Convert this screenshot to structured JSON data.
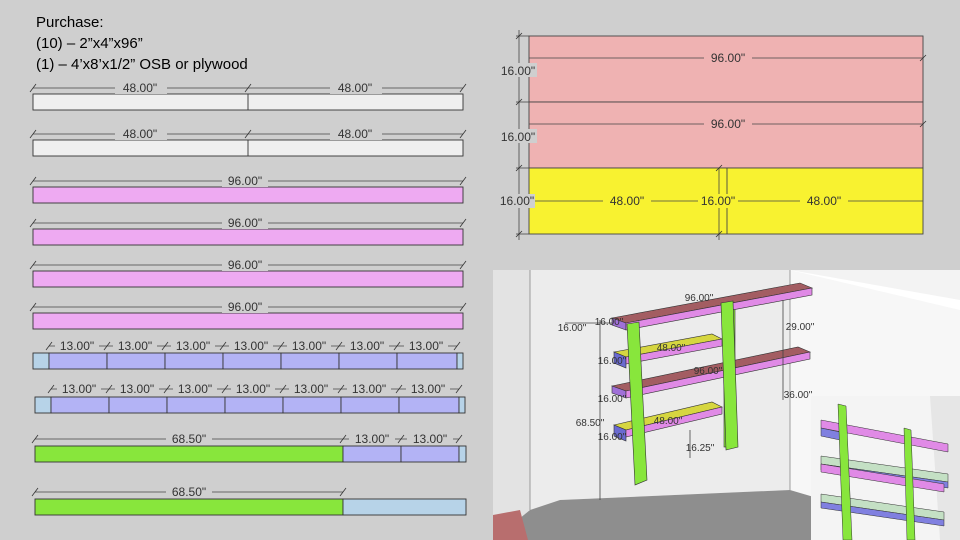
{
  "purchase": {
    "heading": "Purchase:",
    "item1": "(10) – 2”x4”x96”",
    "item2": "(1) – 4’x8’x1/2” OSB or plywood"
  },
  "colors": {
    "background": "#cfcfcf",
    "uncut": "#efefef",
    "long_board": "#eeaaf2",
    "short_piece": "#b3b3f5",
    "leg": "#88e63c",
    "waste": "#b7d3e8",
    "sheet_top": "#efb2b2",
    "sheet_shelf": "#f8f230"
  },
  "boards": {
    "row1": {
      "labels": [
        "48.00\"",
        "48.00\""
      ]
    },
    "row2": {
      "labels": [
        "48.00\"",
        "48.00\""
      ]
    },
    "row3": {
      "label": "96.00\""
    },
    "row4": {
      "label": "96.00\""
    },
    "row5": {
      "label": "96.00\""
    },
    "row6": {
      "label": "96.00\""
    },
    "row7": {
      "labels": [
        "13.00\"",
        "13.00\"",
        "13.00\"",
        "13.00\"",
        "13.00\"",
        "13.00\"",
        "13.00\""
      ]
    },
    "row8": {
      "labels": [
        "13.00\"",
        "13.00\"",
        "13.00\"",
        "13.00\"",
        "13.00\"",
        "13.00\"",
        "13.00\""
      ]
    },
    "row9": {
      "labels": [
        "68.50\"",
        "13.00\"",
        "13.00\""
      ]
    },
    "row10": {
      "label": "68.50\""
    }
  },
  "sheet": {
    "row_heights": [
      "16.00\"",
      "16.00\"",
      "16.00\""
    ],
    "top_length": "96.00\"",
    "middle_length": "96.00\"",
    "bottom_lengths": [
      "48.00\"",
      "16.00\"",
      "48.00\""
    ]
  },
  "iso": {
    "depth": "16.00\"",
    "top_length": "96.00\"",
    "shelf_length_top": "48.00\"",
    "mid_length": "96.00\"",
    "shelf_length_bottom": "48.00\"",
    "upper_gap": "29.00\"",
    "lower_gap": "36.00\"",
    "leg_height": "68.50\"",
    "bottom_clearance": "16.25\"",
    "shelf_depth_labels": [
      "16.00\"",
      "16.00\"",
      "16.00\"",
      "16.00\""
    ]
  }
}
